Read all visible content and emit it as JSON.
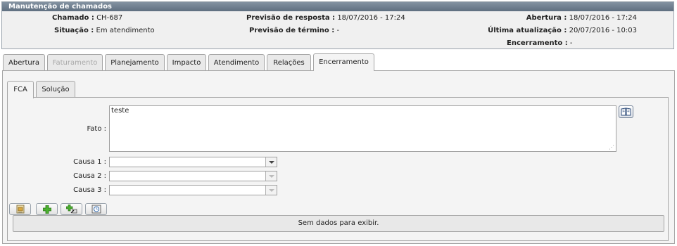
{
  "panel": {
    "title": "Manutenção de chamados",
    "chamado_label": "Chamado :",
    "chamado_value": "CH-687",
    "situacao_label": "Situação :",
    "situacao_value": "Em atendimento",
    "previsao_resposta_label": "Previsão de resposta :",
    "previsao_resposta_value": "18/07/2016 - 17:24",
    "previsao_termino_label": "Previsão de término :",
    "previsao_termino_value": "-",
    "abertura_label": "Abertura :",
    "abertura_value": "18/07/2016 - 17:24",
    "ultima_label": "Última atualização :",
    "ultima_value": "20/07/2016 - 10:03",
    "encerramento_label": "Encerramento :",
    "encerramento_value": "-"
  },
  "tabs": [
    {
      "label": "Abertura"
    },
    {
      "label": "Faturamento"
    },
    {
      "label": "Planejamento"
    },
    {
      "label": "Impacto"
    },
    {
      "label": "Atendimento"
    },
    {
      "label": "Relações"
    },
    {
      "label": "Encerramento"
    }
  ],
  "subtabs": [
    {
      "label": "FCA"
    },
    {
      "label": "Solução"
    }
  ],
  "form": {
    "fato_label": "Fato :",
    "fato_value": "teste",
    "causa1_label": "Causa 1 :",
    "causa1_value": "",
    "causa2_label": "Causa 2 :",
    "causa2_value": "",
    "causa3_label": "Causa 3 :",
    "causa3_value": ""
  },
  "grid": {
    "empty_text": "Sem dados para exibir."
  },
  "icons": {
    "book": "book-icon",
    "folder": "folder-icon",
    "add": "plus-icon",
    "add_edit": "add-edit-icon",
    "clock": "clock-icon"
  }
}
